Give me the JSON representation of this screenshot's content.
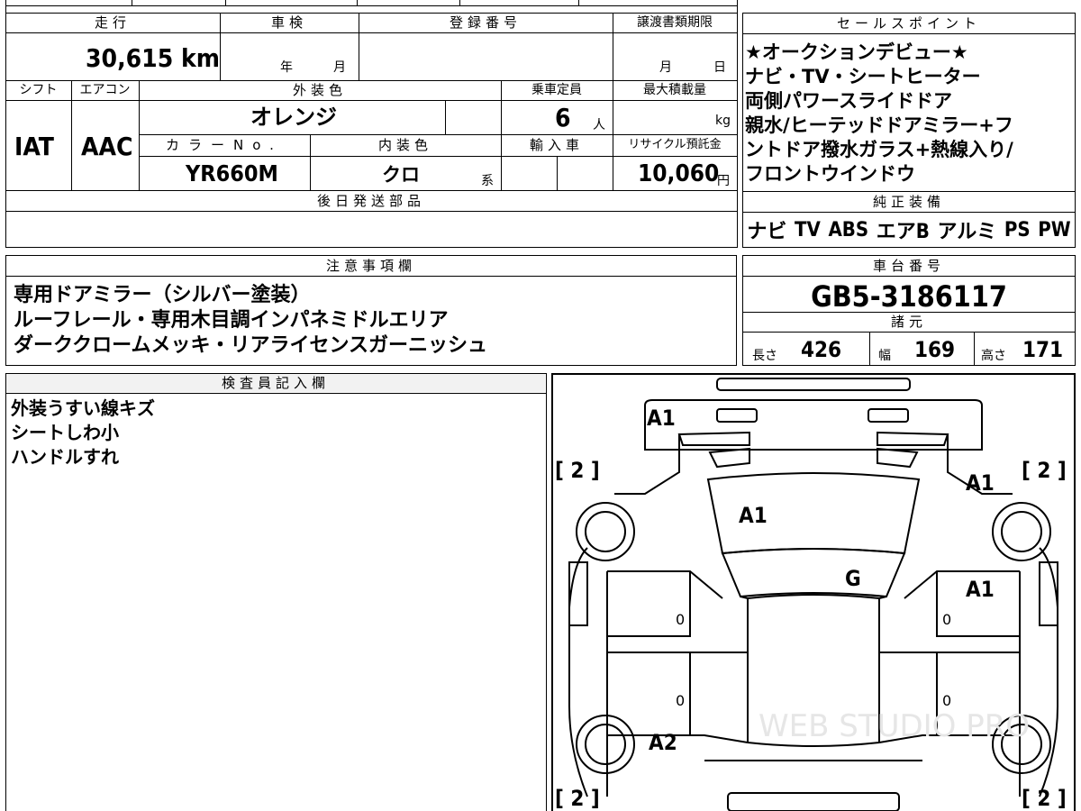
{
  "top_sheet": {
    "mileage": {
      "header": "走行",
      "value": "30,615 km"
    },
    "inspection": {
      "header": "車検",
      "year_unit": "年",
      "month_unit": "月"
    },
    "registration": {
      "header": "登録番号"
    },
    "transfer_deadline": {
      "header": "譲渡書類期限",
      "month_unit": "月",
      "day_unit": "日"
    },
    "shift": {
      "header": "シフト",
      "value": "IAT"
    },
    "aircon": {
      "header": "エアコン",
      "value": "AAC"
    },
    "exterior_color": {
      "header": "外装色",
      "value": "オレンジ"
    },
    "capacity": {
      "header": "乗車定員",
      "value": "6",
      "unit": "人"
    },
    "max_load": {
      "header": "最大積載量",
      "unit": "kg"
    },
    "color_no": {
      "header": "カラーNo.",
      "value": "YR660M"
    },
    "interior_color": {
      "header": "内装色",
      "value": "クロ",
      "suffix": "系"
    },
    "import": {
      "header": "輸入車"
    },
    "recycle": {
      "header": "リサイクル預託金",
      "value": "10,060",
      "unit": "円"
    },
    "later_parts": {
      "header": "後日発送部品"
    }
  },
  "sales_points": {
    "header": "セールスポイント",
    "lines": [
      "★オークションデビュー★",
      "ナビ・TV・シートヒーター",
      "両側パワースライドドア",
      "親水/ヒーテッドドアミラー+フ",
      "ントドア撥水ガラス+熱線入り/",
      "フロントウインドウ"
    ]
  },
  "genuine_equipment": {
    "header": "純正装備",
    "items": [
      "ナビ",
      "TV",
      "ABS",
      "エアB",
      "アルミ",
      "PS",
      "PW"
    ]
  },
  "notes": {
    "header": "注意事項欄",
    "lines": [
      "専用ドアミラー（シルバー塗装）",
      "ルーフレール・専用木目調インパネミドルエリア",
      "ダーククロームメッキ・リアライセンスガーニッシュ"
    ]
  },
  "chassis": {
    "header": "車台番号",
    "value": "GB5-3186117"
  },
  "specs": {
    "header": "諸元",
    "length": {
      "label": "長さ",
      "value": "426"
    },
    "width": {
      "label": "幅",
      "value": "169"
    },
    "height": {
      "label": "高さ",
      "value": "171"
    }
  },
  "inspector": {
    "header": "検査員記入欄",
    "lines": [
      "外装うすい線キズ",
      "シートしわ小",
      "ハンドルすれ"
    ]
  },
  "diagram": {
    "marks": {
      "a1_top": "A1",
      "a1_left_hood": "A1",
      "a1_right_front": "A1",
      "a1_right_mid": "A1",
      "g_windshield": "G",
      "a2_left_rear": "A2"
    },
    "tire_labels": [
      "[ 2 ]",
      "[ 2 ]",
      "[ 2 ]",
      "[ 2 ]"
    ],
    "tread_values": [
      "0",
      "0",
      "0",
      "0"
    ],
    "watermark": "WEB STUDIO PRO"
  },
  "colors": {
    "line": "#000000",
    "background": "#ffffff"
  }
}
